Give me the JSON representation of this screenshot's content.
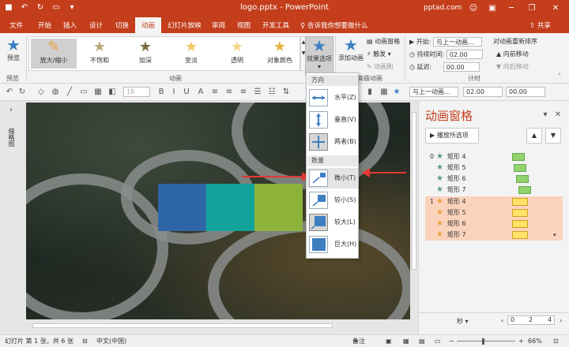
{
  "window": {
    "title": "logo.pptx  -  PowerPoint",
    "site": "pptad.com",
    "user_icon": "user-icon"
  },
  "tabs": [
    "文件",
    "开始",
    "插入",
    "设计",
    "切换",
    "动画",
    "幻灯片放映",
    "审阅",
    "视图",
    "开发工具"
  ],
  "active_tab": "动画",
  "tell_me": "告诉我你想要做什么",
  "share": "共享",
  "ribbon": {
    "preview_label": "预览",
    "preview_group": "预览",
    "animations_group": "动画",
    "gallery": [
      "放大/缩小",
      "不饱和",
      "加深",
      "变淡",
      "透明",
      "对象颜色"
    ],
    "gallery_selected": "放大/缩小",
    "effect_options": "效果选项",
    "add_animation": "添加动画",
    "advanced_group": "高级动画",
    "animation_pane_btn": "动画窗格",
    "trigger": "触发",
    "anim_painter": "动画刷",
    "timing_group": "计时",
    "start_label": "开始:",
    "start_value": "与上一动画...",
    "duration_label": "持续时间:",
    "duration_value": "02.00",
    "delay_label": "延迟:",
    "delay_value": "00.00",
    "reorder_title": "对动画重新排序",
    "move_earlier": "向前移动",
    "move_later": "向后移动"
  },
  "toolbar": {
    "font_size": "18",
    "start_value": "与上一动画...",
    "duration_value": "02.00",
    "delay_value": "00.00"
  },
  "thumbs_label": "缩略图",
  "menu": {
    "dir_header": "方向",
    "directions": [
      "水平(Z)",
      "垂直(V)",
      "两者(B)"
    ],
    "qty_header": "数量",
    "amounts": [
      "微小(T)",
      "较小(S)",
      "较大(L)",
      "巨大(H)"
    ],
    "selected": [
      "两者(B)",
      "较大(L)"
    ],
    "hover": "微小(T)"
  },
  "slide": {
    "rect_colors": [
      "#2f66a8",
      "#13a39a",
      "#8db33a"
    ]
  },
  "pane": {
    "title": "动画窗格",
    "play_btn": "播放所选项",
    "items": [
      {
        "num": "0",
        "name": "矩形 4",
        "color": "green"
      },
      {
        "num": "",
        "name": "矩形 5",
        "color": "green"
      },
      {
        "num": "",
        "name": "矩形 6",
        "color": "green"
      },
      {
        "num": "",
        "name": "矩形 7",
        "color": "green"
      },
      {
        "num": "1",
        "name": "矩形 4",
        "color": "yellow"
      },
      {
        "num": "",
        "name": "矩形 5",
        "color": "yellow"
      },
      {
        "num": "",
        "name": "矩形 6",
        "color": "yellow"
      },
      {
        "num": "",
        "name": "矩形 7",
        "color": "yellow"
      }
    ],
    "seconds": "秒",
    "timeline": [
      "0",
      "2",
      "4"
    ]
  },
  "status": {
    "slide_info": "幻灯片 第 1 张，共 6 张",
    "language": "中文(中国)",
    "notes": "备注",
    "zoom": "66%"
  },
  "colors": {
    "brand": "#c43e1c",
    "green_bar": "#93d36d",
    "yellow_bar": "#ffe26a",
    "highlight_row": "#fbd3bd",
    "arrow": "#e53935"
  }
}
